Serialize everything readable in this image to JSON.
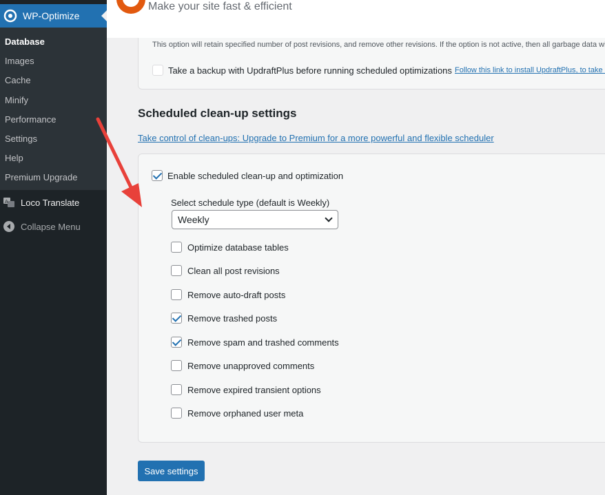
{
  "sidebar": {
    "plugin_title": "WP-Optimize",
    "submenu": [
      "Database",
      "Images",
      "Cache",
      "Minify",
      "Performance",
      "Settings",
      "Help",
      "Premium Upgrade"
    ],
    "loco_translate": "Loco Translate",
    "collapse": "Collapse Menu"
  },
  "header": {
    "tagline": "Make your site fast & efficient"
  },
  "top_card": {
    "note": "This option will retain specified number of post revisions, and remove other revisions. If the option is not active, then all garbage data will",
    "backup_label": "Take a backup with UpdraftPlus before running scheduled optimizations",
    "backup_link": "Follow this link to install UpdraftPlus, to take a"
  },
  "section": {
    "title": "Scheduled clean-up settings",
    "premium_link": "Take control of clean-ups: Upgrade to Premium for a more powerful and flexible scheduler"
  },
  "settings": {
    "enable_label": "Enable scheduled clean-up and optimization",
    "enable_checked": true,
    "schedule_label": "Select schedule type (default is Weekly)",
    "schedule_value": "Weekly",
    "options": [
      {
        "label": "Optimize database tables",
        "checked": false
      },
      {
        "label": "Clean all post revisions",
        "checked": false
      },
      {
        "label": "Remove auto-draft posts",
        "checked": false
      },
      {
        "label": "Remove trashed posts",
        "checked": true
      },
      {
        "label": "Remove spam and trashed comments",
        "checked": true
      },
      {
        "label": "Remove unapproved comments",
        "checked": false
      },
      {
        "label": "Remove expired transient options",
        "checked": false
      },
      {
        "label": "Remove orphaned user meta",
        "checked": false
      }
    ],
    "save_label": "Save settings"
  },
  "colors": {
    "accent": "#2271b1",
    "sidebar": "#1d2327",
    "annotation": "#e8413a"
  }
}
